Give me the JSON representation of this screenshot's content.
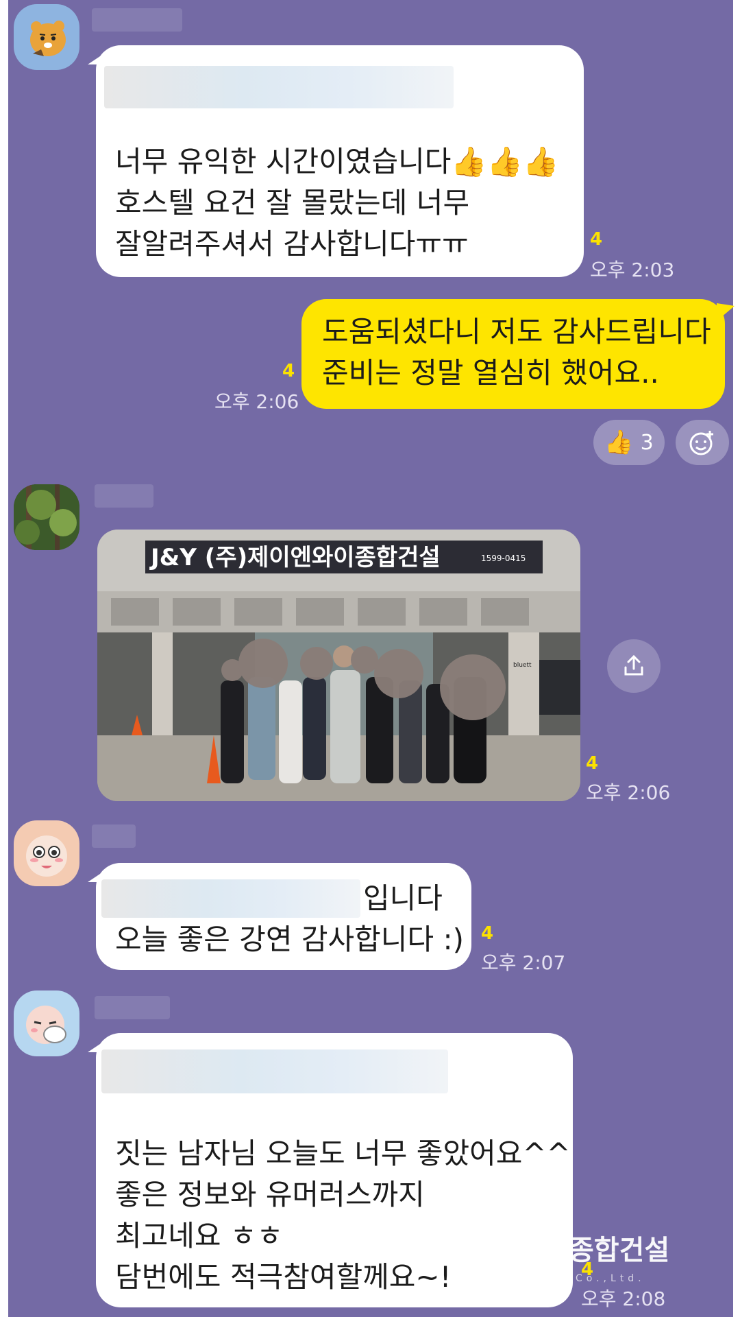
{
  "messages": [
    {
      "lines": [
        "너무 유익한 시간이였습니다👍👍👍",
        "호스텔 요건 잘 몰랐는데 너무",
        "잘알려주셔서 감사합니다ㅠㅠ"
      ],
      "unread": "4",
      "time": "오후 2:03"
    },
    {
      "lines": [
        "도움되셨다니 저도 감사드립니다",
        "준비는 정말 열심히 했어요.."
      ],
      "unread": "4",
      "time": "오후 2:06",
      "reaction_emoji": "👍",
      "reaction_count": "3"
    },
    {
      "photo": {
        "sign_text": "J&Y (주)제이엔와이종합건설",
        "sign_phone": "1599-0415",
        "store_text": "bluett"
      },
      "unread": "4",
      "time": "오후 2:06"
    },
    {
      "lines": [
        "입니다",
        "오늘 좋은 강연 감사합니다 :)"
      ],
      "unread": "4",
      "time": "오후 2:07"
    },
    {
      "lines": [
        "짓는 남자님 오늘도 너무 좋았어요^^",
        "좋은 정보와 유머러스까지",
        "최고네요 ㅎㅎ",
        "담번에도 적극참여할께요~!"
      ],
      "unread": "4",
      "time": "오후 2:08"
    }
  ],
  "watermark": {
    "text": "종합건설",
    "sub": "Co.,Ltd."
  },
  "colors": {
    "chat_bg": "#746AA5",
    "my_bubble": "#FEE500",
    "unread": "#FCE200"
  },
  "icons": [
    "share-icon",
    "add-emoji-icon",
    "thumbs-up-icon"
  ]
}
